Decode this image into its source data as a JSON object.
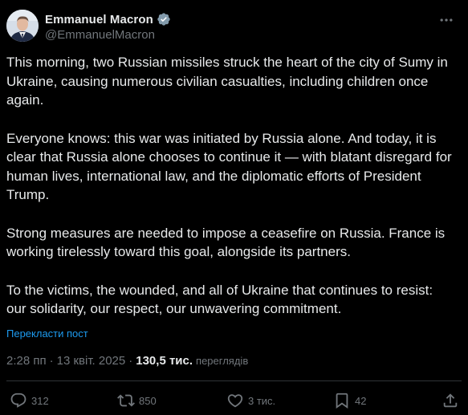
{
  "author": {
    "name": "Emmanuel Macron",
    "handle": "@EmmanuelMacron",
    "verified_color": "#829aab"
  },
  "tweet": {
    "paragraphs": [
      "This morning, two Russian missiles struck the heart of the city of Sumy in Ukraine, causing numerous civilian casualties, including children once again.",
      "Everyone knows: this war was initiated by Russia alone. And today, it is clear that Russia alone chooses to continue it — with blatant disregard for human lives, international law, and the diplomatic efforts of President Trump.",
      "Strong measures are needed to impose a ceasefire on Russia. France is working tirelessly toward this goal, alongside its partners.",
      "To the victims, the wounded, and all of Ukraine that continues to resist: our solidarity, our respect, our unwavering commitment."
    ],
    "translate_label": "Перекласти пост"
  },
  "meta": {
    "time": "2:28 пп",
    "date": "13 квіт. 2025",
    "separator": "·",
    "views_count": "130,5 тис.",
    "views_label": "переглядів"
  },
  "actions": {
    "replies": "312",
    "reposts": "850",
    "likes": "3 тис.",
    "bookmarks": "42"
  },
  "colors": {
    "background": "#000000",
    "text": "#e7e9ea",
    "muted": "#71767b",
    "link": "#1d9bf0",
    "divider": "#2f3336"
  }
}
